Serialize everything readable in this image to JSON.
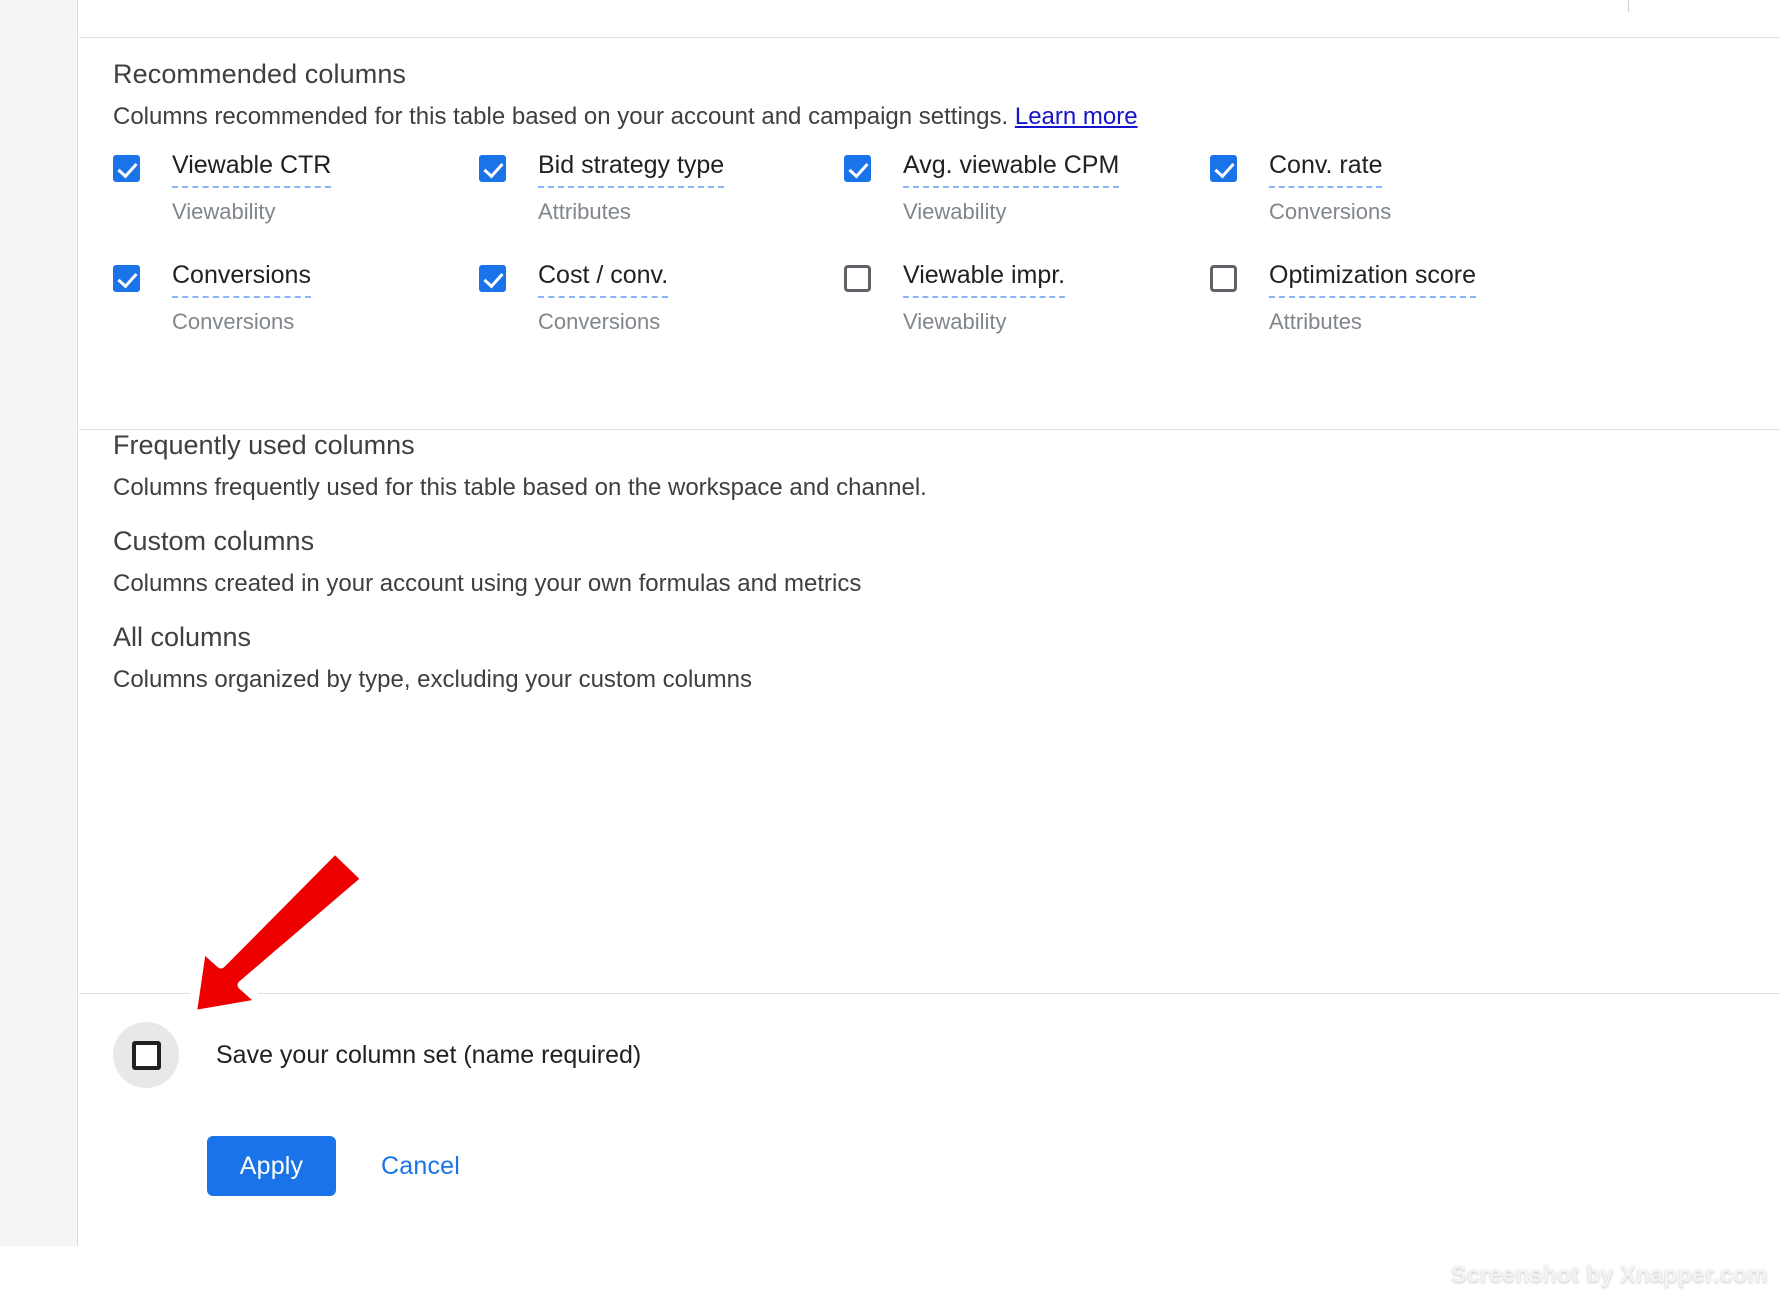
{
  "recommended": {
    "title": "Recommended columns",
    "description": "Columns recommended for this table based on your account and campaign settings.",
    "learn_more": "Learn more",
    "columns": [
      {
        "label": "Viewable CTR",
        "category": "Viewability",
        "checked": true
      },
      {
        "label": "Bid strategy type",
        "category": "Attributes",
        "checked": true
      },
      {
        "label": "Avg. viewable CPM",
        "category": "Viewability",
        "checked": true
      },
      {
        "label": "Conv. rate",
        "category": "Conversions",
        "checked": true
      },
      {
        "label": "Conversions",
        "category": "Conversions",
        "checked": true
      },
      {
        "label": "Cost / conv.",
        "category": "Conversions",
        "checked": true
      },
      {
        "label": "Viewable impr.",
        "category": "Viewability",
        "checked": false
      },
      {
        "label": "Optimization score",
        "category": "Attributes",
        "checked": false
      }
    ]
  },
  "sections": [
    {
      "title": "Frequently used columns",
      "description": "Columns frequently used for this table based on the workspace and channel."
    },
    {
      "title": "Custom columns",
      "description": "Columns created in your account using your own formulas and metrics"
    },
    {
      "title": "All columns",
      "description": "Columns organized by type, excluding your custom columns"
    }
  ],
  "footer": {
    "save_label": "Save your column set (name required)",
    "save_checked": false,
    "apply_label": "Apply",
    "cancel_label": "Cancel"
  },
  "watermark": "Screenshot by Xnapper.com",
  "colors": {
    "accent": "#1a73e8",
    "link": "#1414c8",
    "text": "#202124",
    "muted": "#80868b",
    "arrow": "#ee0000"
  }
}
